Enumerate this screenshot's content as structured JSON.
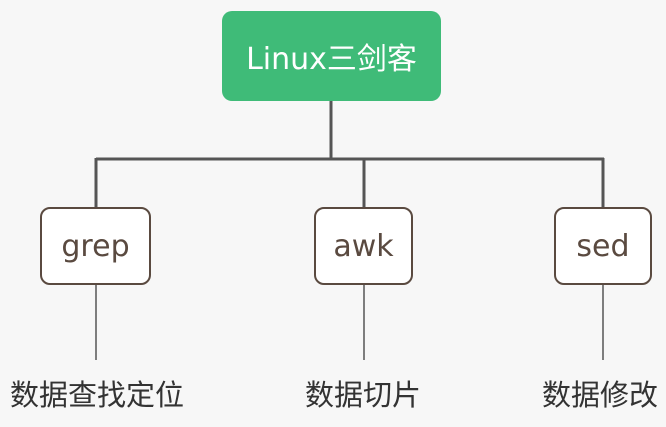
{
  "diagram": {
    "root": {
      "label": "Linux三剑客",
      "color": "#3fbb78"
    },
    "children": [
      {
        "label": "grep",
        "caption": "数据查找定位"
      },
      {
        "label": "awk",
        "caption": "数据切片"
      },
      {
        "label": "sed",
        "caption": "数据修改"
      }
    ],
    "line_color": "#555555",
    "box_border_color": "#5a4a40"
  }
}
